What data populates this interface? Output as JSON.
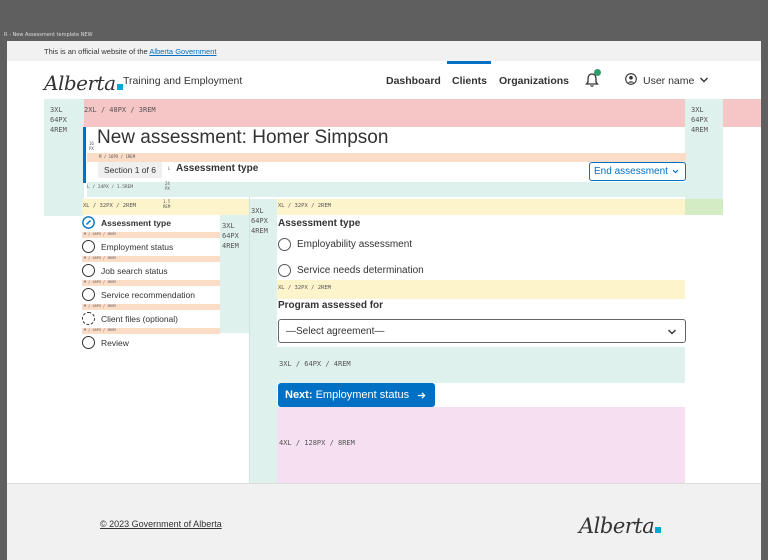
{
  "window": {
    "title": "R - New Assessment template NEW"
  },
  "official_banner": {
    "text": "This is an official website of the",
    "link": "Alberta Government"
  },
  "header": {
    "logo_text": "Alberta",
    "service_name": "Training and Employment",
    "nav": [
      {
        "label": "Dashboard",
        "active": false
      },
      {
        "label": "Clients",
        "active": true
      },
      {
        "label": "Organizations",
        "active": false
      }
    ],
    "user_name": "User name",
    "accent": "#0070c4"
  },
  "spacers": {
    "left_col": "3XL\n64PX\n4REM",
    "top_row": "2XL / 48PX / 3REM",
    "right_col": "3XL\n64PX\n4REM",
    "m16_a": "M / 16PX / 1REM",
    "l24": "L / 24PX / 1.5REM",
    "xl32_left": "XL / 32PX / 2REM",
    "xl32_content": "XL / 32PX / 2REM",
    "mid_col": "3XL\n64PX\n4REM",
    "inner_col": "3XL\n64PX\n4REM",
    "m16_step": "M / 16PX / 1REM",
    "xl32_program": "XL / 32PX / 2REM",
    "xl3_bottom": "3XL / 64PX / 4REM",
    "xxl4": "4XL / 128PX / 8REM",
    "tiny_1": "16\nPX",
    "tiny_2": "24\nPX",
    "tiny_3": "1.5\nREM",
    "tiny_4": "L"
  },
  "page": {
    "title": "New assessment: Homer Simpson",
    "section_badge": "Section 1 of 6",
    "section_title": "Assessment type",
    "end_button": "End assessment"
  },
  "steps": [
    {
      "label": "Assessment type",
      "state": "current"
    },
    {
      "label": "Employment status",
      "state": "todo"
    },
    {
      "label": "Job search status",
      "state": "todo"
    },
    {
      "label": "Service recommendation",
      "state": "todo"
    },
    {
      "label": "Client files (optional)",
      "state": "optional"
    },
    {
      "label": "Review",
      "state": "todo"
    }
  ],
  "form": {
    "heading": "Assessment type",
    "options": [
      "Employability assessment",
      "Service needs determination"
    ],
    "program_label": "Program assessed for",
    "select_value": "—Select agreement—",
    "next_prefix": "Next:",
    "next_label": "Employment status"
  },
  "footer": {
    "copyright": "© 2023 Government of Alberta",
    "logo_text": "Alberta"
  }
}
